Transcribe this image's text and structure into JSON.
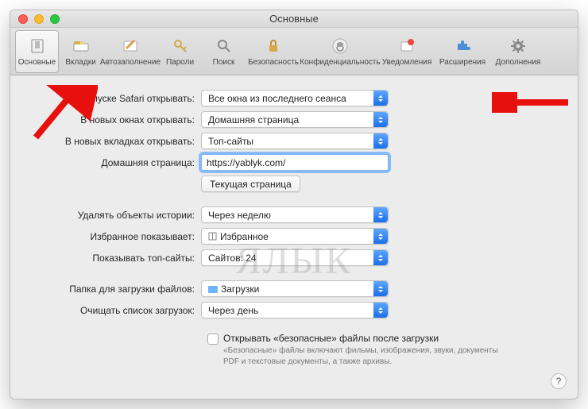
{
  "window": {
    "title": "Основные"
  },
  "toolbar": {
    "items": [
      {
        "label": "Основные"
      },
      {
        "label": "Вкладки"
      },
      {
        "label": "Автозаполнение"
      },
      {
        "label": "Пароли"
      },
      {
        "label": "Поиск"
      },
      {
        "label": "Безопасность"
      },
      {
        "label": "Конфиденциальность"
      },
      {
        "label": "Уведомления"
      },
      {
        "label": "Расширения"
      },
      {
        "label": "Дополнения"
      }
    ]
  },
  "form": {
    "launch_label": "При запуске Safari открывать:",
    "launch_value": "Все окна из последнего сеанса",
    "new_windows_label": "В новых окнах открывать:",
    "new_windows_value": "Домашняя страница",
    "new_tabs_label": "В новых вкладках открывать:",
    "new_tabs_value": "Топ-сайты",
    "homepage_label": "Домашняя страница:",
    "homepage_value": "https://yablyk.com/",
    "current_page_btn": "Текущая страница",
    "history_label": "Удалять объекты истории:",
    "history_value": "Через неделю",
    "favorites_label": "Избранное показывает:",
    "favorites_value": "Избранное",
    "topsites_label": "Показывать топ-сайты:",
    "topsites_value": "Сайтов: 24",
    "downloads_folder_label": "Папка для загрузки файлов:",
    "downloads_folder_value": "Загрузки",
    "downloads_clear_label": "Очищать список загрузок:",
    "downloads_clear_value": "Через день",
    "safe_checkbox_label": "Открывать «безопасные» файлы после загрузки",
    "safe_desc": "«Безопасные» файлы включают фильмы, изображения, звуки, документы PDF и текстовые документы, а также архивы."
  },
  "help": "?",
  "watermark": {
    "left": "Я",
    "right": "ЛЫК"
  }
}
